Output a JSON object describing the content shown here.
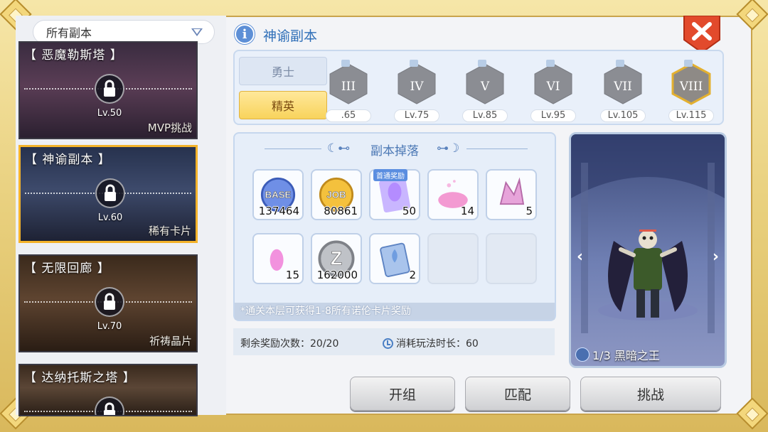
{
  "filter": {
    "label": "所有副本"
  },
  "dungeons": [
    {
      "title": "【 恶魔勒斯塔 】",
      "level": "Lv.50",
      "tag": "MVP挑战",
      "selected": false
    },
    {
      "title": "【 神谕副本 】",
      "level": "Lv.60",
      "tag": "稀有卡片",
      "selected": true
    },
    {
      "title": "【 无限回廊 】",
      "level": "Lv.70",
      "tag": "祈祷晶片",
      "selected": false
    },
    {
      "title": "【 达纳托斯之塔 】",
      "level": "",
      "tag": "",
      "selected": false
    }
  ],
  "panel": {
    "info_glyph": "i",
    "title": "神谕副本"
  },
  "difficulty": {
    "warrior": "勇士",
    "elite": "精英"
  },
  "tiers": [
    {
      "numeral": "III",
      "level": ".65"
    },
    {
      "numeral": "IV",
      "level": "Lv.75"
    },
    {
      "numeral": "V",
      "level": "Lv.85"
    },
    {
      "numeral": "VI",
      "level": "Lv.95"
    },
    {
      "numeral": "VII",
      "level": "Lv.105"
    },
    {
      "numeral": "VIII",
      "level": "Lv.115"
    }
  ],
  "drops": {
    "title": "副本掉落",
    "items": [
      {
        "name": "base-exp-icon",
        "count": "137464",
        "ribbon": "",
        "badge": "BASE"
      },
      {
        "name": "job-exp-icon",
        "count": "80861",
        "ribbon": "",
        "badge": "JOB"
      },
      {
        "name": "card-pack-icon",
        "count": "50",
        "ribbon": "首通奖励",
        "badge": ""
      },
      {
        "name": "pink-powder-icon",
        "count": "14",
        "ribbon": "",
        "badge": ""
      },
      {
        "name": "pink-crystal-icon",
        "count": "5",
        "ribbon": "",
        "badge": ""
      },
      {
        "name": "pink-gem-icon",
        "count": "15",
        "ribbon": "",
        "badge": ""
      },
      {
        "name": "zeny-coin-icon",
        "count": "162000",
        "ribbon": "",
        "badge": "Z"
      },
      {
        "name": "blue-card-icon",
        "count": "2",
        "ribbon": "",
        "badge": ""
      }
    ],
    "note": "*通关本层可获得1-8所有诺伦卡片奖励"
  },
  "stats": {
    "remaining": "剩余奖励次数：20/20",
    "time_cost": "消耗玩法时长：60"
  },
  "boss": {
    "name": "1/3 黑暗之王",
    "prev": "‹",
    "next": "›"
  },
  "actions": {
    "team": "开组",
    "match": "匹配",
    "challenge": "挑战"
  },
  "colors": {
    "accent": "#2f6fb8",
    "selected_border": "#f4b32a",
    "close": "#e24a2c"
  }
}
